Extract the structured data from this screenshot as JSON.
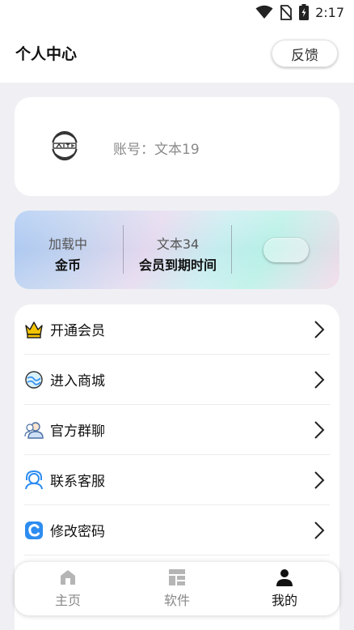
{
  "status_bar": {
    "time": "2:17"
  },
  "header": {
    "title": "个人中心",
    "feedback_label": "反馈"
  },
  "profile": {
    "account_text": "账号：文本19"
  },
  "vip_card": {
    "coins_value": "加载中",
    "coins_label": "金币",
    "expire_value": "文本34",
    "expire_label": "会员到期时间"
  },
  "menu": {
    "items": [
      {
        "label": "开通会员",
        "icon": "crown-icon"
      },
      {
        "label": "进入商城",
        "icon": "shop-icon"
      },
      {
        "label": "官方群聊",
        "icon": "group-chat-icon"
      },
      {
        "label": "联系客服",
        "icon": "customer-service-icon"
      },
      {
        "label": "修改密码",
        "icon": "password-icon"
      }
    ]
  },
  "bottom_nav": {
    "items": [
      {
        "label": "主页",
        "icon": "home-icon",
        "active": false
      },
      {
        "label": "软件",
        "icon": "apps-icon",
        "active": false
      },
      {
        "label": "我的",
        "icon": "profile-icon",
        "active": true
      }
    ]
  },
  "colors": {
    "accent_blue": "#2d8cf0",
    "inactive_gray": "#888888",
    "background": "#f0f0f4"
  }
}
